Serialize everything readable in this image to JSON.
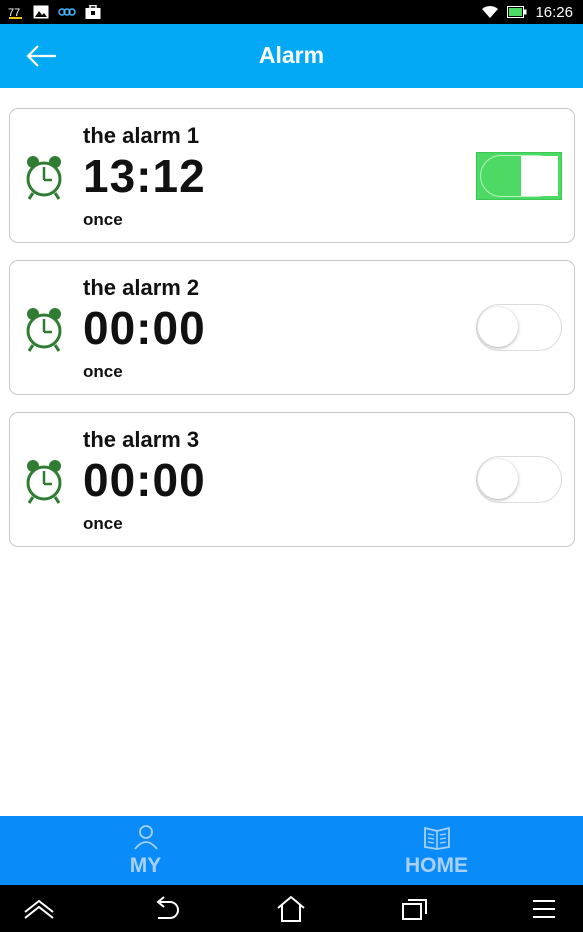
{
  "status_bar": {
    "time": "16:26",
    "icons": [
      "notification-icon",
      "image-icon",
      "link-icon",
      "briefcase-icon",
      "wifi-icon",
      "battery-icon"
    ]
  },
  "header": {
    "title": "Alarm",
    "back_icon": "arrow-left-icon",
    "background_color": "#03A9F4"
  },
  "alarms": [
    {
      "name": "the alarm 1",
      "time": "13:12",
      "repeat": "once",
      "enabled": true
    },
    {
      "name": "the alarm 2",
      "time": "00:00",
      "repeat": "once",
      "enabled": false
    },
    {
      "name": "the alarm 3",
      "time": "00:00",
      "repeat": "once",
      "enabled": false
    }
  ],
  "colors": {
    "clock_icon": "#2E7D32",
    "toggle_on": "#4CD964",
    "tab_bar": "#0A8BFA"
  },
  "tabs": [
    {
      "label": "MY",
      "icon": "person-icon"
    },
    {
      "label": "HOME",
      "icon": "book-icon"
    }
  ],
  "nav_bar": {
    "buttons": [
      "up-arrow-icon",
      "back-icon",
      "home-icon",
      "recent-apps-icon",
      "menu-icon"
    ]
  }
}
